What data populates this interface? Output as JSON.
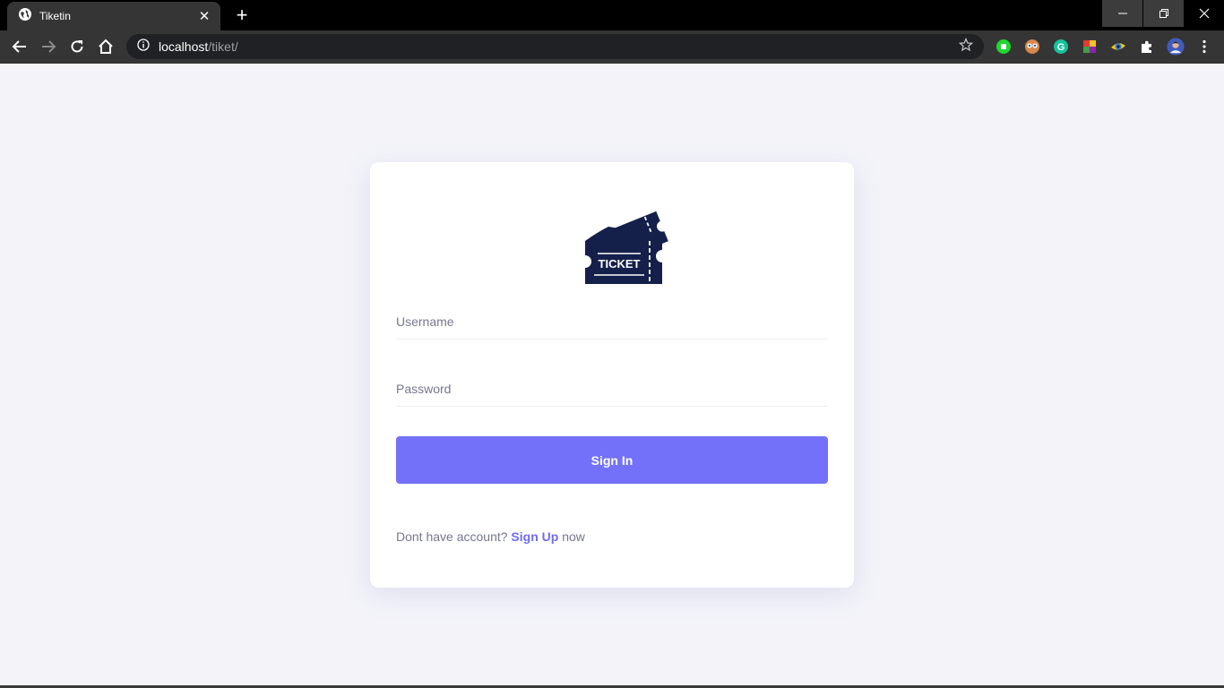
{
  "browser": {
    "tab_title": "Tiketin",
    "tab_close": "✕",
    "new_tab": "+",
    "url_host": "localhost",
    "url_path": "/tiket/",
    "window_controls": {
      "minimize": "—",
      "restore": "❐",
      "close": "✕"
    }
  },
  "login": {
    "logo_text": "TICKET",
    "username_placeholder": "Username",
    "password_placeholder": "Password",
    "signin_label": "Sign In",
    "footer_prefix": "Dont have account?",
    "signup_link": "Sign Up",
    "footer_suffix": "now"
  },
  "colors": {
    "page_bg": "#f3f3f9",
    "accent": "#7371fa",
    "logo_navy": "#14204a"
  },
  "icons": [
    "globe-icon",
    "back-icon",
    "forward-icon",
    "reload-icon",
    "home-icon",
    "info-icon",
    "star-icon",
    "puzzle-icon",
    "menu-icon",
    "ticket-logo"
  ]
}
